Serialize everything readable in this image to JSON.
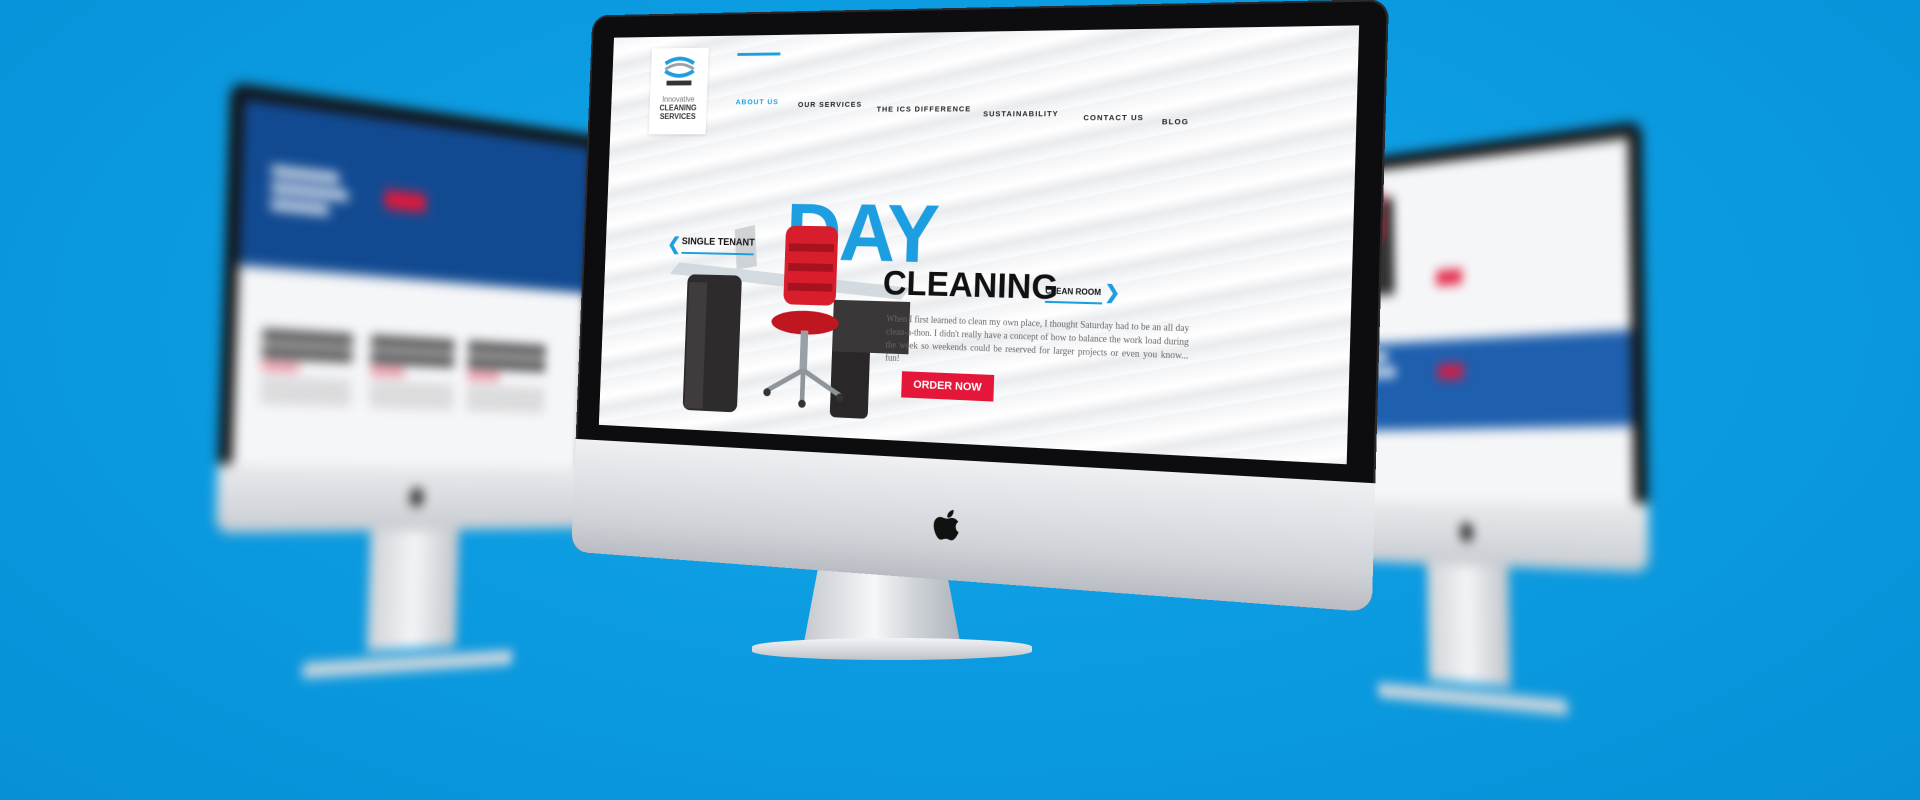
{
  "website": {
    "logo": {
      "line1": "Innovative",
      "line2": "CLEANING",
      "line3": "SERVICES"
    },
    "nav": [
      {
        "label": "ABOUT US",
        "active": true
      },
      {
        "label": "OUR SERVICES",
        "active": false
      },
      {
        "label": "THE ICS DIFFERENCE",
        "active": false
      },
      {
        "label": "SUSTAINABILITY",
        "active": false
      },
      {
        "label": "CONTACT US",
        "active": false
      },
      {
        "label": "BLOG",
        "active": false
      }
    ],
    "hero": {
      "title_top": "DAY",
      "title_bottom": "CLEANING",
      "prev_label": "SINGLE TENANT",
      "next_label": "CLEAN ROOM",
      "body": "When I first learned to clean my own place, I thought Saturday had to be an all day clean-a-thon. I didn't really have a concept of how to balance the work load during the week so weekends could be reserved for larger projects or even you know... fun!",
      "cta": "ORDER NOW"
    }
  },
  "colors": {
    "background": "#0b9ae0",
    "accent_blue": "#1d9ee0",
    "accent_red": "#e4173a"
  },
  "icons": {
    "prev": "chevron-left-icon",
    "next": "chevron-right-icon",
    "brand": "apple-logo-icon"
  }
}
